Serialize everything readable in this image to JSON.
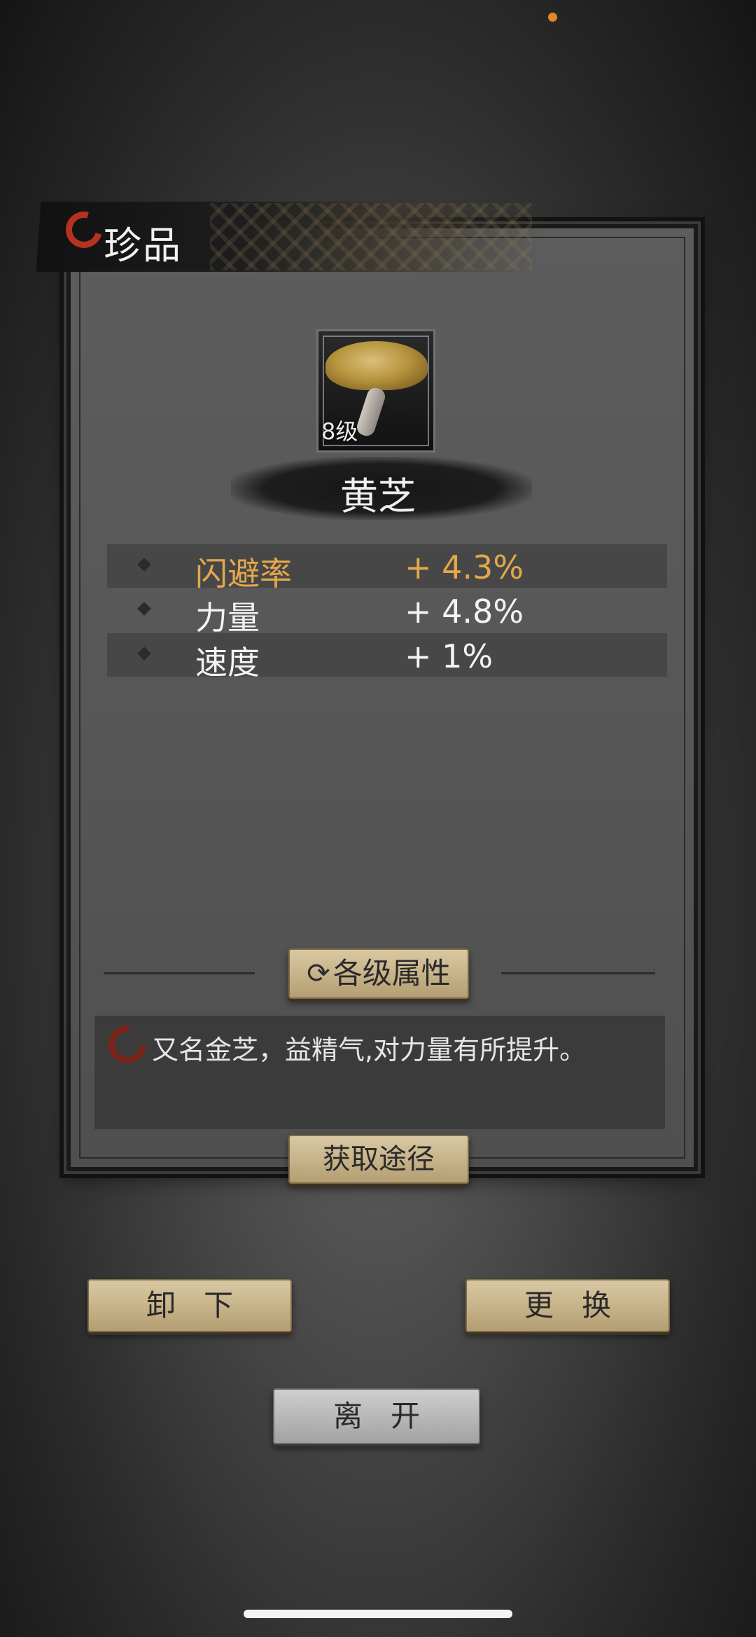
{
  "header": {
    "title": "珍品"
  },
  "item": {
    "level": "8级",
    "name": "黄芝",
    "icon": "lingzhi-mushroom-icon"
  },
  "stats": [
    {
      "label": "闪避率",
      "value": "+ 4.3%",
      "highlight": true
    },
    {
      "label": "力量",
      "value": "+ 4.8%",
      "highlight": false
    },
    {
      "label": "速度",
      "value": "+ 1%",
      "highlight": false
    }
  ],
  "buttons": {
    "level_attributes": "各级属性",
    "acquire_source": "获取途径",
    "unequip": "卸下",
    "replace": "更换",
    "leave": "离开"
  },
  "description": "又名金芝，益精气,对力量有所提升。",
  "colors": {
    "highlight": "#e3a84a",
    "status_dot": "#e2862a",
    "seal_red": "#b5321f"
  }
}
